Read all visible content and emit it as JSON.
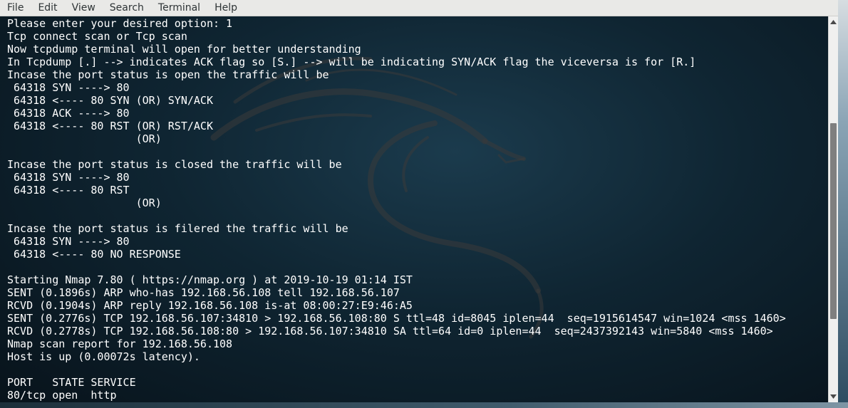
{
  "menubar": {
    "items": [
      "File",
      "Edit",
      "View",
      "Search",
      "Terminal",
      "Help"
    ]
  },
  "terminal": {
    "lines": [
      "Please enter your desired option: 1",
      "Tcp connect scan or Tcp scan",
      "Now tcpdump terminal will open for better understanding",
      "In Tcpdump [.] --> indicates ACK flag so [S.] --> will be indicating SYN/ACK flag the viceversa is for [R.]",
      "Incase the port status is open the traffic will be",
      " 64318 SYN ----> 80",
      " 64318 <---- 80 SYN (OR) SYN/ACK",
      " 64318 ACK ----> 80",
      " 64318 <---- 80 RST (OR) RST/ACK",
      "                    (OR)",
      "",
      "Incase the port status is closed the traffic will be",
      " 64318 SYN ----> 80",
      " 64318 <---- 80 RST",
      "                    (OR)",
      "",
      "Incase the port status is filered the traffic will be",
      " 64318 SYN ----> 80",
      " 64318 <---- 80 NO RESPONSE",
      "",
      "Starting Nmap 7.80 ( https://nmap.org ) at 2019-10-19 01:14 IST",
      "SENT (0.1896s) ARP who-has 192.168.56.108 tell 192.168.56.107",
      "RCVD (0.1904s) ARP reply 192.168.56.108 is-at 08:00:27:E9:46:A5",
      "SENT (0.2776s) TCP 192.168.56.107:34810 > 192.168.56.108:80 S ttl=48 id=8045 iplen=44  seq=1915614547 win=1024 <mss 1460>",
      "RCVD (0.2778s) TCP 192.168.56.108:80 > 192.168.56.107:34810 SA ttl=64 id=0 iplen=44  seq=2437392143 win=5840 <mss 1460>",
      "Nmap scan report for 192.168.56.108",
      "Host is up (0.00072s latency).",
      "",
      "PORT   STATE SERVICE",
      "80/tcp open  http"
    ]
  },
  "scrollbar": {
    "up_icon": "triangle-up",
    "down_icon": "triangle-down",
    "position": 0.47
  },
  "colors": {
    "menubar_bg": "#e9e9e7",
    "terminal_text": "#ffffff",
    "terminal_bg": "#0f2532"
  }
}
